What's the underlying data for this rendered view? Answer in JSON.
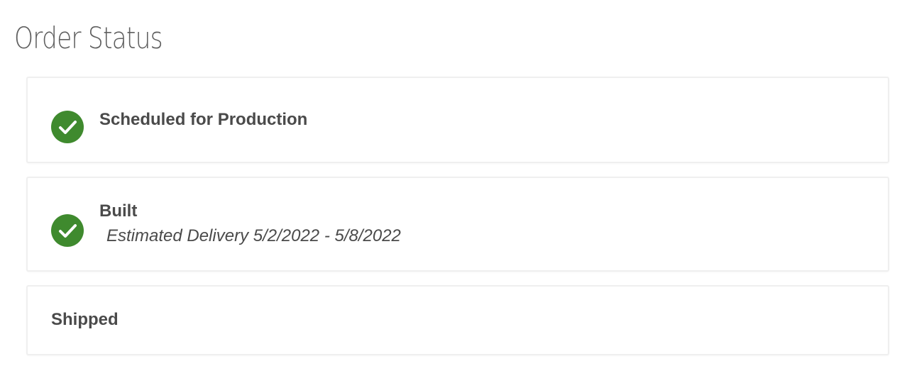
{
  "page": {
    "title": "Order Status"
  },
  "statuses": [
    {
      "label": "Scheduled for Production",
      "completed": true,
      "icon": "check-circle-icon",
      "detail": ""
    },
    {
      "label": "Built",
      "completed": true,
      "icon": "check-circle-icon",
      "detail": "Estimated Delivery 5/2/2022 - 5/8/2022"
    },
    {
      "label": "Shipped",
      "completed": false,
      "detail": ""
    }
  ],
  "colors": {
    "check": "#3f8a2e",
    "text": "#4a4a4a",
    "title": "#5f5f5f",
    "card_border": "#efefef"
  }
}
